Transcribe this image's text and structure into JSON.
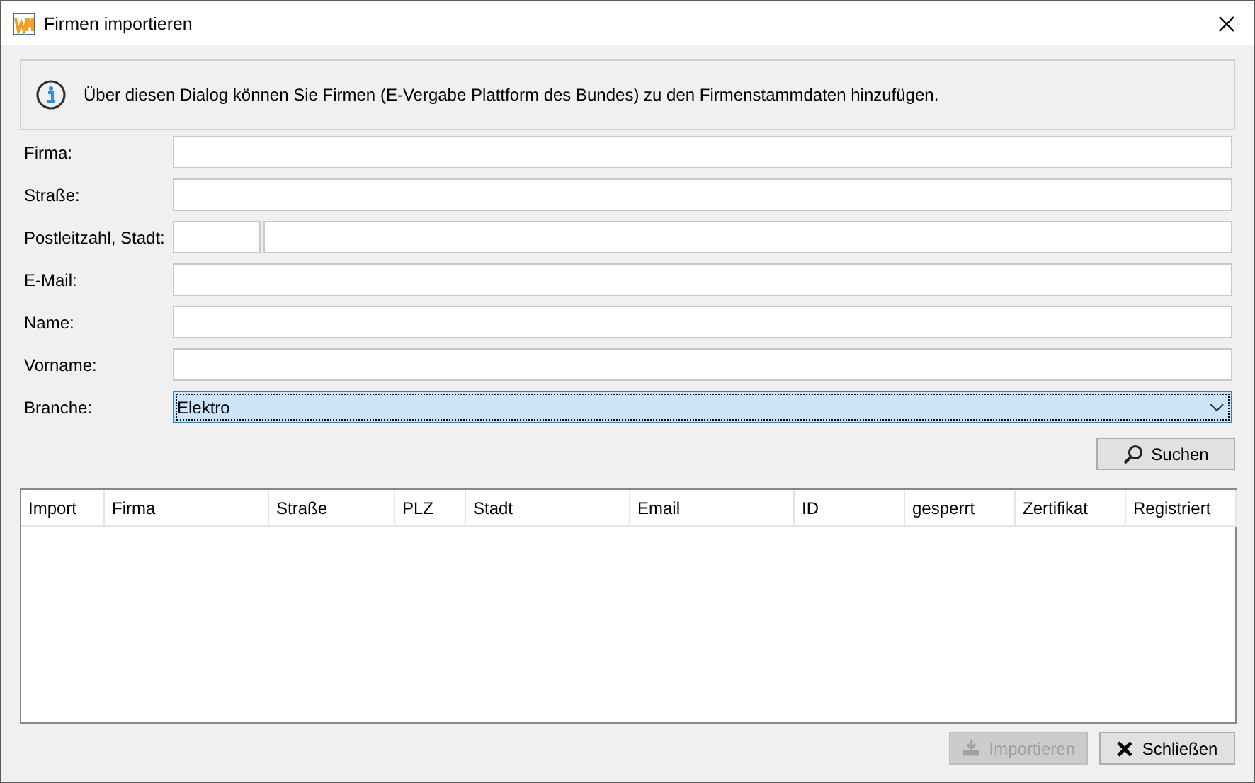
{
  "window": {
    "title": "Firmen importieren"
  },
  "info": "Über diesen Dialog können Sie Firmen (E-Vergabe Plattform des Bundes) zu den Firmenstammdaten hinzufügen.",
  "form": [
    {
      "kind": "text",
      "label": "Firma:"
    },
    {
      "kind": "text",
      "label": "Straße:"
    },
    {
      "kind": "zip-city",
      "label": "Postleitzahl, Stadt:"
    },
    {
      "kind": "text",
      "label": "E-Mail:"
    },
    {
      "kind": "text",
      "label": "Name:"
    },
    {
      "kind": "text",
      "label": "Vorname:"
    },
    {
      "kind": "select",
      "label": "Branche:",
      "value": "Elektro"
    }
  ],
  "search_button": "Suchen",
  "table": {
    "columns": [
      "Import",
      "Firma",
      "Straße",
      "PLZ",
      "Stadt",
      "Email",
      "ID",
      "gesperrt",
      "Zertifikat",
      "Registriert"
    ]
  },
  "buttons": [
    {
      "kind": "import",
      "label": "Importieren",
      "disabled": true
    },
    {
      "kind": "close",
      "label": "Schließen",
      "disabled": false
    }
  ]
}
